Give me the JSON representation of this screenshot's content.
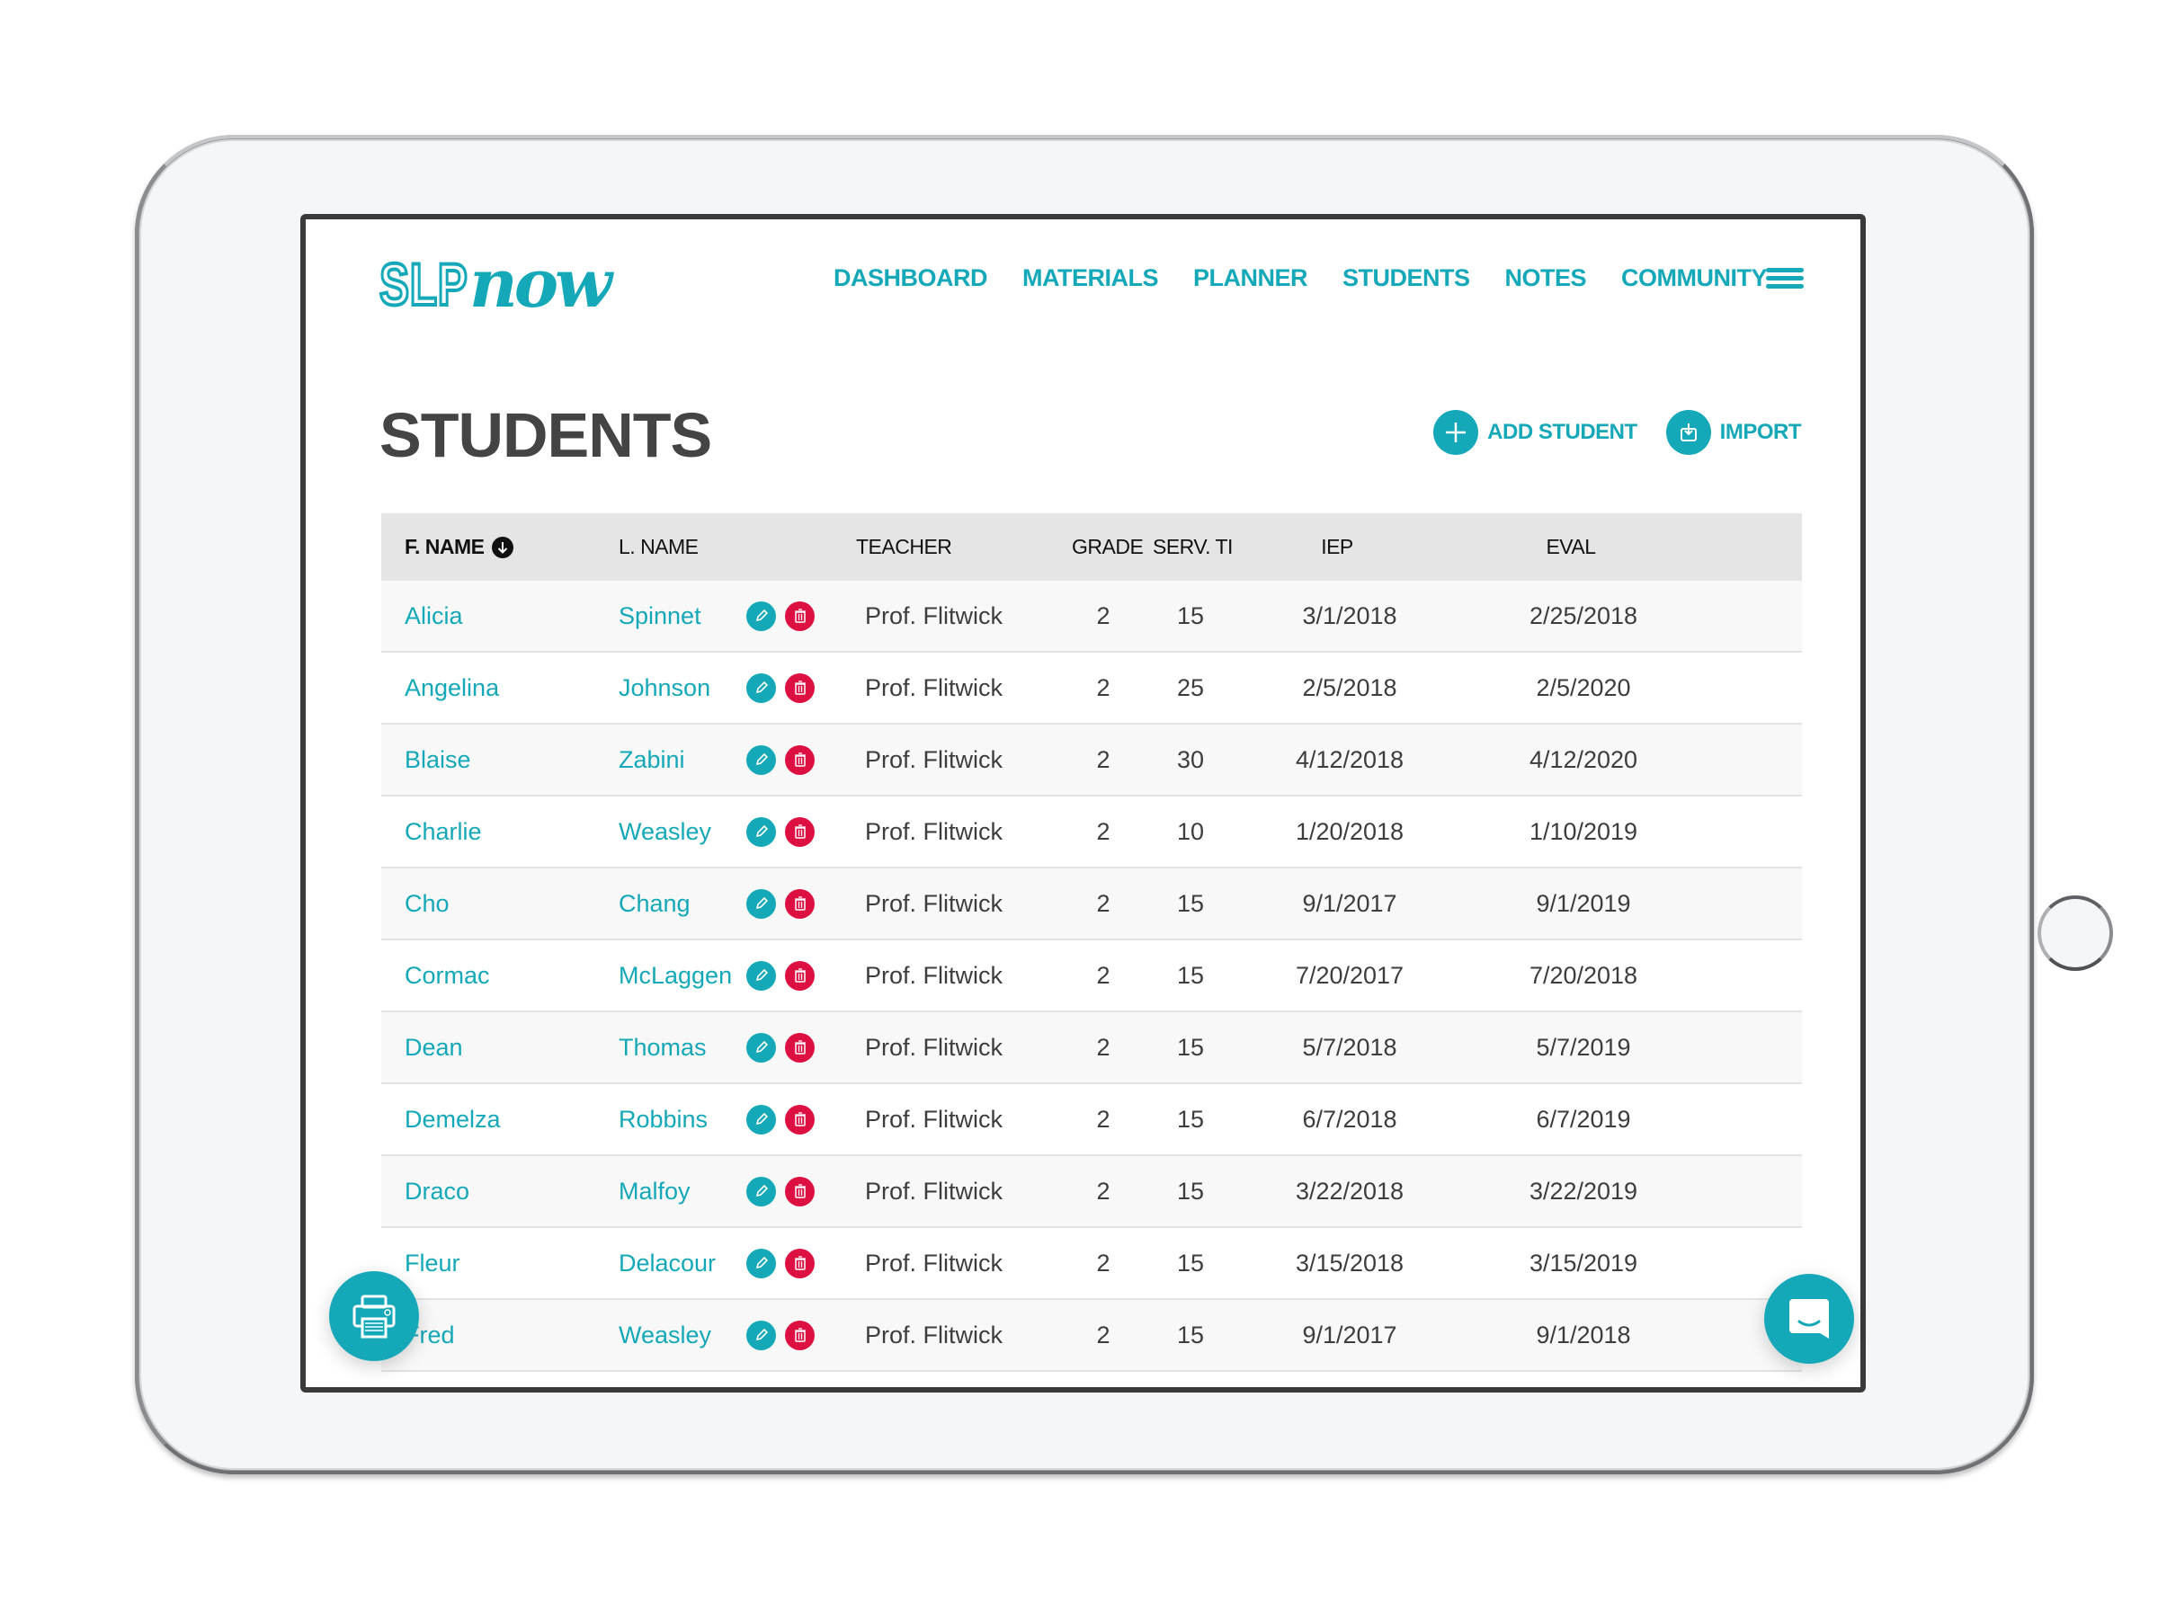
{
  "brand": {
    "logo_part1": "SLP",
    "logo_part2": "now",
    "accent_color": "#14a8b8",
    "danger_color": "#dd1042"
  },
  "nav": {
    "items": [
      {
        "label": "DASHBOARD"
      },
      {
        "label": "MATERIALS"
      },
      {
        "label": "PLANNER"
      },
      {
        "label": "STUDENTS"
      },
      {
        "label": "NOTES"
      },
      {
        "label": "COMMUNITY"
      }
    ],
    "menu_icon": "hamburger-icon"
  },
  "page": {
    "title": "STUDENTS",
    "add_student_label": "ADD STUDENT",
    "import_label": "IMPORT"
  },
  "table": {
    "columns": {
      "fname": "F. NAME",
      "lname": "L. NAME",
      "teacher": "TEACHER",
      "grade": "GRADE",
      "serv": "SERV. TI",
      "iep": "IEP",
      "eval": "EVAL"
    },
    "sort": {
      "column": "fname",
      "direction": "descending-arrow"
    },
    "rows": [
      {
        "fname": "Alicia",
        "lname": "Spinnet",
        "teacher": "Prof. Flitwick",
        "grade": "2",
        "serv": "15",
        "iep": "3/1/2018",
        "eval": "2/25/2018"
      },
      {
        "fname": "Angelina",
        "lname": "Johnson",
        "teacher": "Prof. Flitwick",
        "grade": "2",
        "serv": "25",
        "iep": "2/5/2018",
        "eval": "2/5/2020"
      },
      {
        "fname": "Blaise",
        "lname": "Zabini",
        "teacher": "Prof. Flitwick",
        "grade": "2",
        "serv": "30",
        "iep": "4/12/2018",
        "eval": "4/12/2020"
      },
      {
        "fname": "Charlie",
        "lname": "Weasley",
        "teacher": "Prof. Flitwick",
        "grade": "2",
        "serv": "10",
        "iep": "1/20/2018",
        "eval": "1/10/2019"
      },
      {
        "fname": "Cho",
        "lname": "Chang",
        "teacher": "Prof. Flitwick",
        "grade": "2",
        "serv": "15",
        "iep": "9/1/2017",
        "eval": "9/1/2019"
      },
      {
        "fname": "Cormac",
        "lname": "McLaggen",
        "teacher": "Prof. Flitwick",
        "grade": "2",
        "serv": "15",
        "iep": "7/20/2017",
        "eval": "7/20/2018"
      },
      {
        "fname": "Dean",
        "lname": "Thomas",
        "teacher": "Prof. Flitwick",
        "grade": "2",
        "serv": "15",
        "iep": "5/7/2018",
        "eval": "5/7/2019"
      },
      {
        "fname": "Demelza",
        "lname": "Robbins",
        "teacher": "Prof. Flitwick",
        "grade": "2",
        "serv": "15",
        "iep": "6/7/2018",
        "eval": "6/7/2019"
      },
      {
        "fname": "Draco",
        "lname": "Malfoy",
        "teacher": "Prof. Flitwick",
        "grade": "2",
        "serv": "15",
        "iep": "3/22/2018",
        "eval": "3/22/2019"
      },
      {
        "fname": "Fleur",
        "lname": "Delacour",
        "teacher": "Prof. Flitwick",
        "grade": "2",
        "serv": "15",
        "iep": "3/15/2018",
        "eval": "3/15/2019"
      },
      {
        "fname": "Fred",
        "lname": "Weasley",
        "teacher": "Prof. Flitwick",
        "grade": "2",
        "serv": "15",
        "iep": "9/1/2017",
        "eval": "9/1/2018"
      },
      {
        "fname": "",
        "lname": "",
        "teacher": "",
        "grade": "",
        "serv": "",
        "iep": "",
        "eval": ""
      }
    ]
  },
  "floating": {
    "print_icon": "printer-icon",
    "chat_icon": "chat-bubble-icon"
  }
}
